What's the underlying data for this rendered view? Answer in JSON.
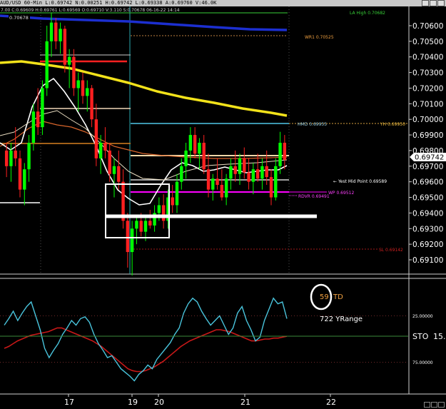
{
  "header": {
    "title_line": "AUD/USD 60-Min L:0.69742 N:0.00251 H:0.69742 L:0.69338 A:0.69760 V:46.0K",
    "info_line": "7.00 C:0.69609 H:0.69761 L:0.69569 O:0.69710 V:3.110 S:0.70678 06-16-22 14:14"
  },
  "price_axis": {
    "ticks": [
      "0.70600",
      "0.70500",
      "0.70400",
      "0.70300",
      "0.70200",
      "0.70100",
      "0.70000",
      "0.69900",
      "0.69800",
      "0.69700",
      "0.69600",
      "0.69500",
      "0.69400",
      "0.69300",
      "0.69200",
      "0.69100"
    ],
    "last_price": "0.69742",
    "top_price_label": "0.70678"
  },
  "osc_axis": {
    "ticks": [
      "25.00000",
      "75.00000"
    ],
    "label": "STO",
    "value": "15."
  },
  "date_labels": [
    "17",
    "19",
    "20",
    "21",
    "22"
  ],
  "annotations": {
    "cut_top": "LA High 0.70682",
    "wr1": "WR1 0.70525",
    "hmd": "HMD 0.69955",
    "yh": "YH 0.69950",
    "yest_mid": "Yest Mid Point 0.69589",
    "wp": "WP 0.69512",
    "rdvr": "RDVR 0.69491",
    "sl": "SL 0.69142",
    "td": "59",
    "td_suffix": "TD",
    "yrange": "722 YRange"
  },
  "colors": {
    "up_candle": "#00ff00",
    "down_candle": "#ff2020",
    "ma_blue": "#1c2fd0",
    "ma_yellow": "#f2e21a",
    "ma_white": "#ffffff",
    "ma_orange": "#d8652b",
    "level_magenta": "#ff00ff",
    "level_cyan": "#50c8e8",
    "stoch_k": "#49c4dc",
    "stoch_d": "#c81818",
    "td_text": "#f0a040"
  },
  "chart_data": {
    "type": "candlestick",
    "symbol": "AUD/USD",
    "timeframe": "60-Min",
    "price_range": [
      0.69,
      0.707
    ],
    "osc_ticks": [
      25,
      75
    ],
    "sessions": [
      "17",
      "19",
      "20",
      "21",
      "22"
    ],
    "levels": [
      {
        "label": "WR1",
        "value": 0.70525
      },
      {
        "label": "HMD",
        "value": 0.69955
      },
      {
        "label": "YH",
        "value": 0.6995
      },
      {
        "label": "Yest Mid Point",
        "value": 0.69589
      },
      {
        "label": "WP",
        "value": 0.69512
      },
      {
        "label": "RDVR",
        "value": 0.69491
      },
      {
        "label": "SL",
        "value": 0.69142
      }
    ],
    "candles": [
      [
        0.698,
        0.6985,
        0.6963,
        0.697
      ],
      [
        0.697,
        0.6985,
        0.696,
        0.698
      ],
      [
        0.698,
        0.6995,
        0.697,
        0.6975
      ],
      [
        0.6975,
        0.698,
        0.695,
        0.6955
      ],
      [
        0.6955,
        0.6972,
        0.6945,
        0.6968
      ],
      [
        0.6968,
        0.699,
        0.696,
        0.6985
      ],
      [
        0.6985,
        0.701,
        0.698,
        0.7005
      ],
      [
        0.7005,
        0.702,
        0.699,
        0.6995
      ],
      [
        0.6995,
        0.7025,
        0.699,
        0.702
      ],
      [
        0.702,
        0.706,
        0.7015,
        0.705
      ],
      [
        0.705,
        0.7068,
        0.704,
        0.7062
      ],
      [
        0.7062,
        0.7065,
        0.7045,
        0.705
      ],
      [
        0.705,
        0.7062,
        0.7042,
        0.7058
      ],
      [
        0.7058,
        0.706,
        0.703,
        0.7035
      ],
      [
        0.7035,
        0.7045,
        0.702,
        0.704
      ],
      [
        0.704,
        0.7045,
        0.7015,
        0.702
      ],
      [
        0.702,
        0.703,
        0.7005,
        0.7025
      ],
      [
        0.7025,
        0.703,
        0.701,
        0.7015
      ],
      [
        0.7015,
        0.7025,
        0.7005,
        0.702
      ],
      [
        0.702,
        0.7022,
        0.6995,
        0.7
      ],
      [
        0.7,
        0.701,
        0.697,
        0.6975
      ],
      [
        0.6975,
        0.699,
        0.6965,
        0.6985
      ],
      [
        0.6985,
        0.6995,
        0.6975,
        0.698
      ],
      [
        0.698,
        0.6985,
        0.696,
        0.6965
      ],
      [
        0.6965,
        0.6975,
        0.695,
        0.697
      ],
      [
        0.697,
        0.698,
        0.6955,
        0.696
      ],
      [
        0.696,
        0.6968,
        0.693,
        0.6935
      ],
      [
        0.6935,
        0.694,
        0.6905,
        0.6915
      ],
      [
        0.6915,
        0.6935,
        0.69,
        0.693
      ],
      [
        0.693,
        0.6938,
        0.692,
        0.6935
      ],
      [
        0.6935,
        0.694,
        0.6925,
        0.6928
      ],
      [
        0.6928,
        0.6938,
        0.6922,
        0.6935
      ],
      [
        0.6935,
        0.6942,
        0.693,
        0.6932
      ],
      [
        0.6932,
        0.6945,
        0.6928,
        0.694
      ],
      [
        0.694,
        0.695,
        0.6935,
        0.6945
      ],
      [
        0.6945,
        0.6952,
        0.693,
        0.6935
      ],
      [
        0.6935,
        0.6955,
        0.693,
        0.695
      ],
      [
        0.695,
        0.6958,
        0.694,
        0.6945
      ],
      [
        0.6945,
        0.6965,
        0.694,
        0.696
      ],
      [
        0.696,
        0.6975,
        0.6955,
        0.697
      ],
      [
        0.697,
        0.6985,
        0.6962,
        0.698
      ],
      [
        0.698,
        0.6995,
        0.6972,
        0.699
      ],
      [
        0.699,
        0.6995,
        0.6975,
        0.6978
      ],
      [
        0.6978,
        0.6988,
        0.6968,
        0.6985
      ],
      [
        0.6985,
        0.699,
        0.6965,
        0.6968
      ],
      [
        0.6968,
        0.6978,
        0.695,
        0.6955
      ],
      [
        0.6955,
        0.6965,
        0.6948,
        0.6962
      ],
      [
        0.6962,
        0.6975,
        0.6955,
        0.6958
      ],
      [
        0.6958,
        0.6968,
        0.6948,
        0.695
      ],
      [
        0.695,
        0.6965,
        0.6945,
        0.6962
      ],
      [
        0.6962,
        0.6975,
        0.6955,
        0.697
      ],
      [
        0.697,
        0.698,
        0.696,
        0.6965
      ],
      [
        0.6965,
        0.6978,
        0.6958,
        0.6975
      ],
      [
        0.6975,
        0.6982,
        0.6962,
        0.6966
      ],
      [
        0.6966,
        0.6975,
        0.6955,
        0.696
      ],
      [
        0.696,
        0.6972,
        0.6952,
        0.6968
      ],
      [
        0.6968,
        0.6978,
        0.696,
        0.6962
      ],
      [
        0.6962,
        0.6975,
        0.6955,
        0.697
      ],
      [
        0.697,
        0.698,
        0.6958,
        0.6963
      ],
      [
        0.6963,
        0.6968,
        0.6945,
        0.695
      ],
      [
        0.695,
        0.6975,
        0.6948,
        0.697
      ],
      [
        0.697,
        0.6992,
        0.6965,
        0.6985
      ],
      [
        0.6985,
        0.699,
        0.6968,
        0.6974
      ]
    ],
    "stochastic_k": [
      35,
      28,
      20,
      30,
      22,
      15,
      10,
      25,
      40,
      60,
      70,
      62,
      55,
      45,
      38,
      30,
      35,
      28,
      26,
      32,
      45,
      55,
      62,
      70,
      68,
      75,
      82,
      86,
      90,
      95,
      88,
      84,
      78,
      82,
      72,
      66,
      60,
      54,
      45,
      38,
      22,
      12,
      6,
      10,
      20,
      28,
      35,
      30,
      25,
      35,
      45,
      38,
      22,
      15,
      30,
      40,
      52,
      48,
      30,
      18,
      6,
      12,
      10,
      28
    ],
    "stochastic_d": [
      60,
      58,
      55,
      52,
      50,
      48,
      46,
      45,
      44,
      43,
      42,
      40,
      38,
      38,
      40,
      42,
      44,
      46,
      48,
      50,
      52,
      55,
      58,
      62,
      66,
      70,
      74,
      78,
      82,
      84,
      85,
      85,
      84,
      82,
      80,
      77,
      74,
      70,
      66,
      62,
      58,
      55,
      52,
      50,
      48,
      46,
      44,
      42,
      40,
      40,
      41,
      42,
      44,
      46,
      48,
      50,
      52,
      52,
      51,
      50,
      50,
      49,
      49,
      48,
      47
    ]
  }
}
